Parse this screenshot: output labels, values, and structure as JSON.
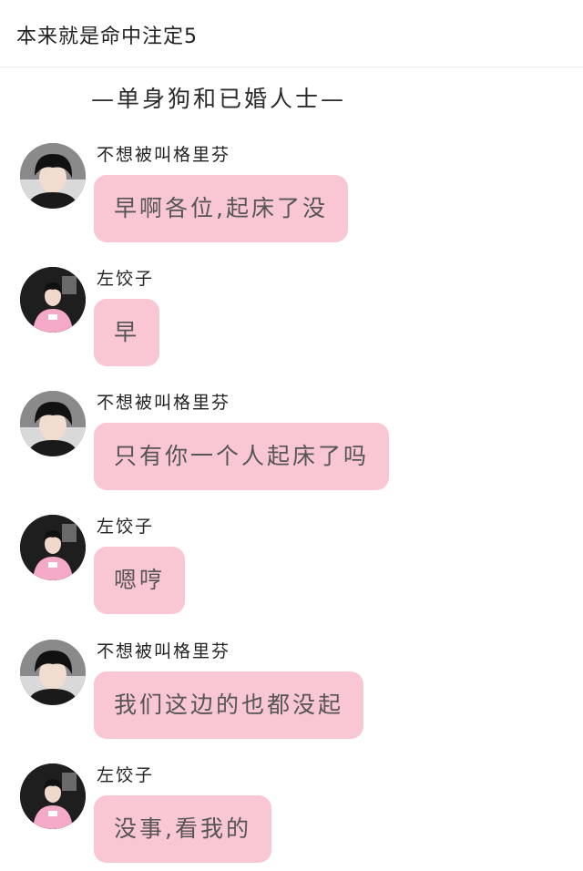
{
  "header": {
    "title": "本来就是命中注定5"
  },
  "subtitle": "—单身狗和已婚人士—",
  "messages": [
    {
      "sender": "不想被叫格里芬",
      "avatar_icon": "user-avatar-black-hair-icon",
      "text": "早啊各位,起床了没"
    },
    {
      "sender": "左饺子",
      "avatar_icon": "user-avatar-pink-shirt-icon",
      "text": "早"
    },
    {
      "sender": "不想被叫格里芬",
      "avatar_icon": "user-avatar-black-hair-icon",
      "text": "只有你一个人起床了吗"
    },
    {
      "sender": "左饺子",
      "avatar_icon": "user-avatar-pink-shirt-icon",
      "text": "嗯哼"
    },
    {
      "sender": "不想被叫格里芬",
      "avatar_icon": "user-avatar-black-hair-icon",
      "text": "我们这边的也都没起"
    },
    {
      "sender": "左饺子",
      "avatar_icon": "user-avatar-pink-shirt-icon",
      "text": "没事,看我的"
    }
  ],
  "colors": {
    "bubble": "#f9c7d3",
    "divider": "#ececec",
    "avatar_bg": "#1a1a1a",
    "pink_shirt": "#f4a9c9"
  }
}
